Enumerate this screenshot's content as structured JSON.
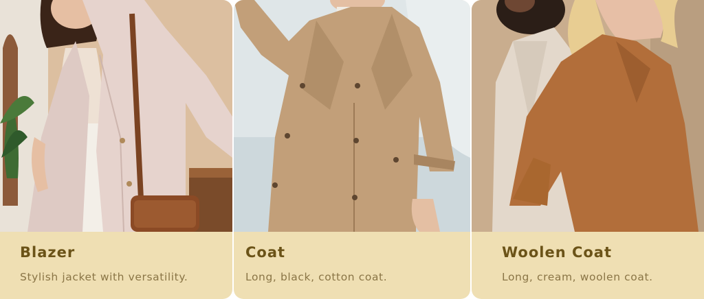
{
  "products": [
    {
      "title": "Blazer",
      "description": "Stylish jacket with versatility.",
      "image_alt": "Woman wearing a light pink blazer with a brown leather bag"
    },
    {
      "title": "Coat",
      "description": "Long, black, cotton coat.",
      "image_alt": "Woman wearing a beige trench coat"
    },
    {
      "title": "Woolen Coat",
      "description": "Long, cream, woolen coat.",
      "image_alt": "Two women wearing cream and camel woolen coats"
    }
  ],
  "colors": {
    "card_background": "#efdfb3",
    "title": "#6b5318",
    "description": "#8a7546"
  }
}
